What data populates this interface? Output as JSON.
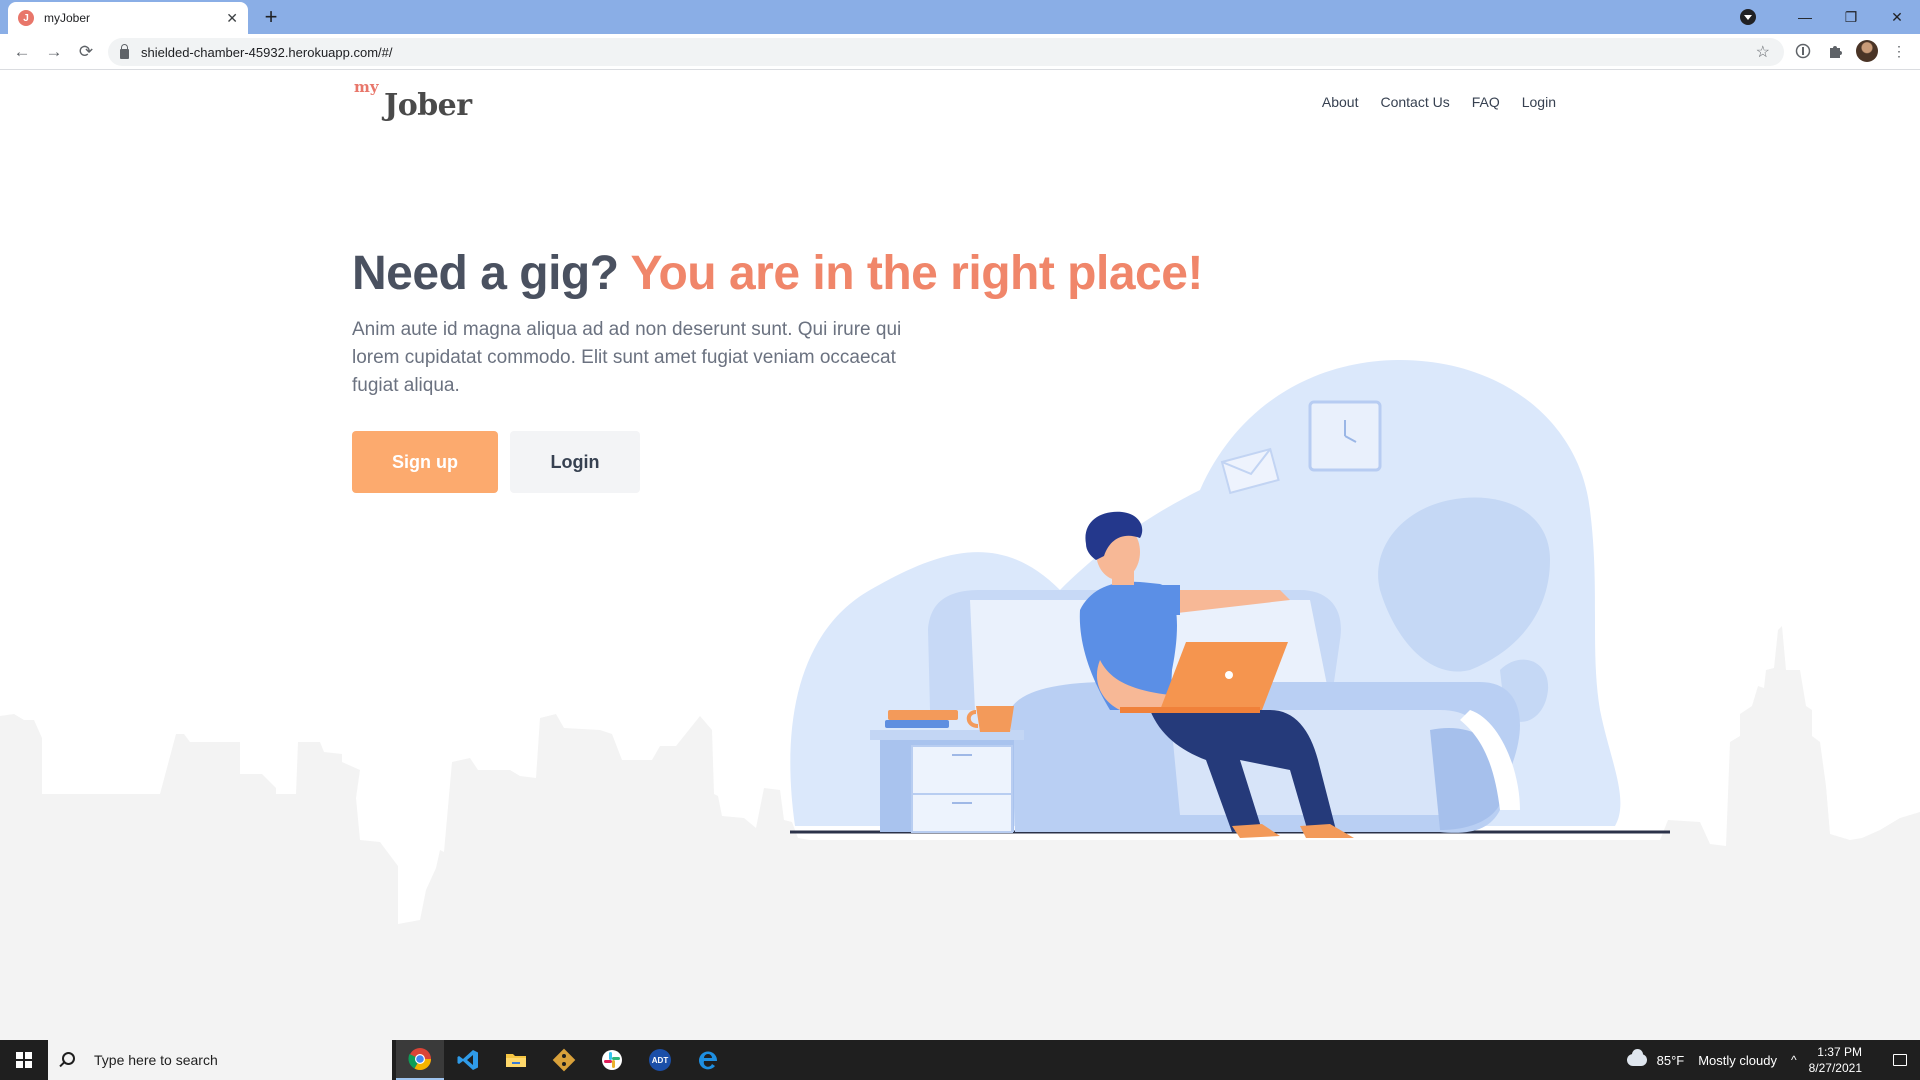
{
  "browser": {
    "tab_title": "myJober",
    "tab_favicon": "J",
    "close_glyph": "✕",
    "new_tab_glyph": "+",
    "url": "shielded-chamber-45932.herokuapp.com/#/",
    "back_glyph": "←",
    "forward_glyph": "→",
    "reload_glyph": "⟳",
    "star_glyph": "☆",
    "menu_glyph": "⋮",
    "minimize_glyph": "—",
    "restore_glyph": "❐",
    "window_close_glyph": "✕"
  },
  "site": {
    "logo_my": "my",
    "logo_jober": "Jober",
    "nav": [
      "About",
      "Contact Us",
      "FAQ",
      "Login"
    ]
  },
  "hero": {
    "title_main": "Need a gig?",
    "title_accent": "You are in the right place!",
    "text": "Anim aute id magna aliqua ad ad non deserunt sunt. Qui irure qui lorem cupidatat commodo. Elit sunt amet fugiat veniam occaecat fugiat aliqua.",
    "signup_label": "Sign up",
    "login_label": "Login"
  },
  "taskbar": {
    "search_placeholder": "Type here to search",
    "apps": [
      "chrome-icon",
      "vscode-icon",
      "file-explorer-icon",
      "git-icon",
      "slack-icon",
      "adt-icon",
      "edge-icon"
    ],
    "weather_temp": "85°F",
    "weather_desc": "Mostly cloudy",
    "time": "1:37 PM",
    "date": "8/27/2021",
    "chevron_glyph": "^",
    "adt_label": "ADT"
  },
  "colors": {
    "accent": "#f0866a",
    "primary_button": "#fcaa6e",
    "tabbar": "#8aaee6",
    "illustration_blue": "#dbe8fb"
  }
}
